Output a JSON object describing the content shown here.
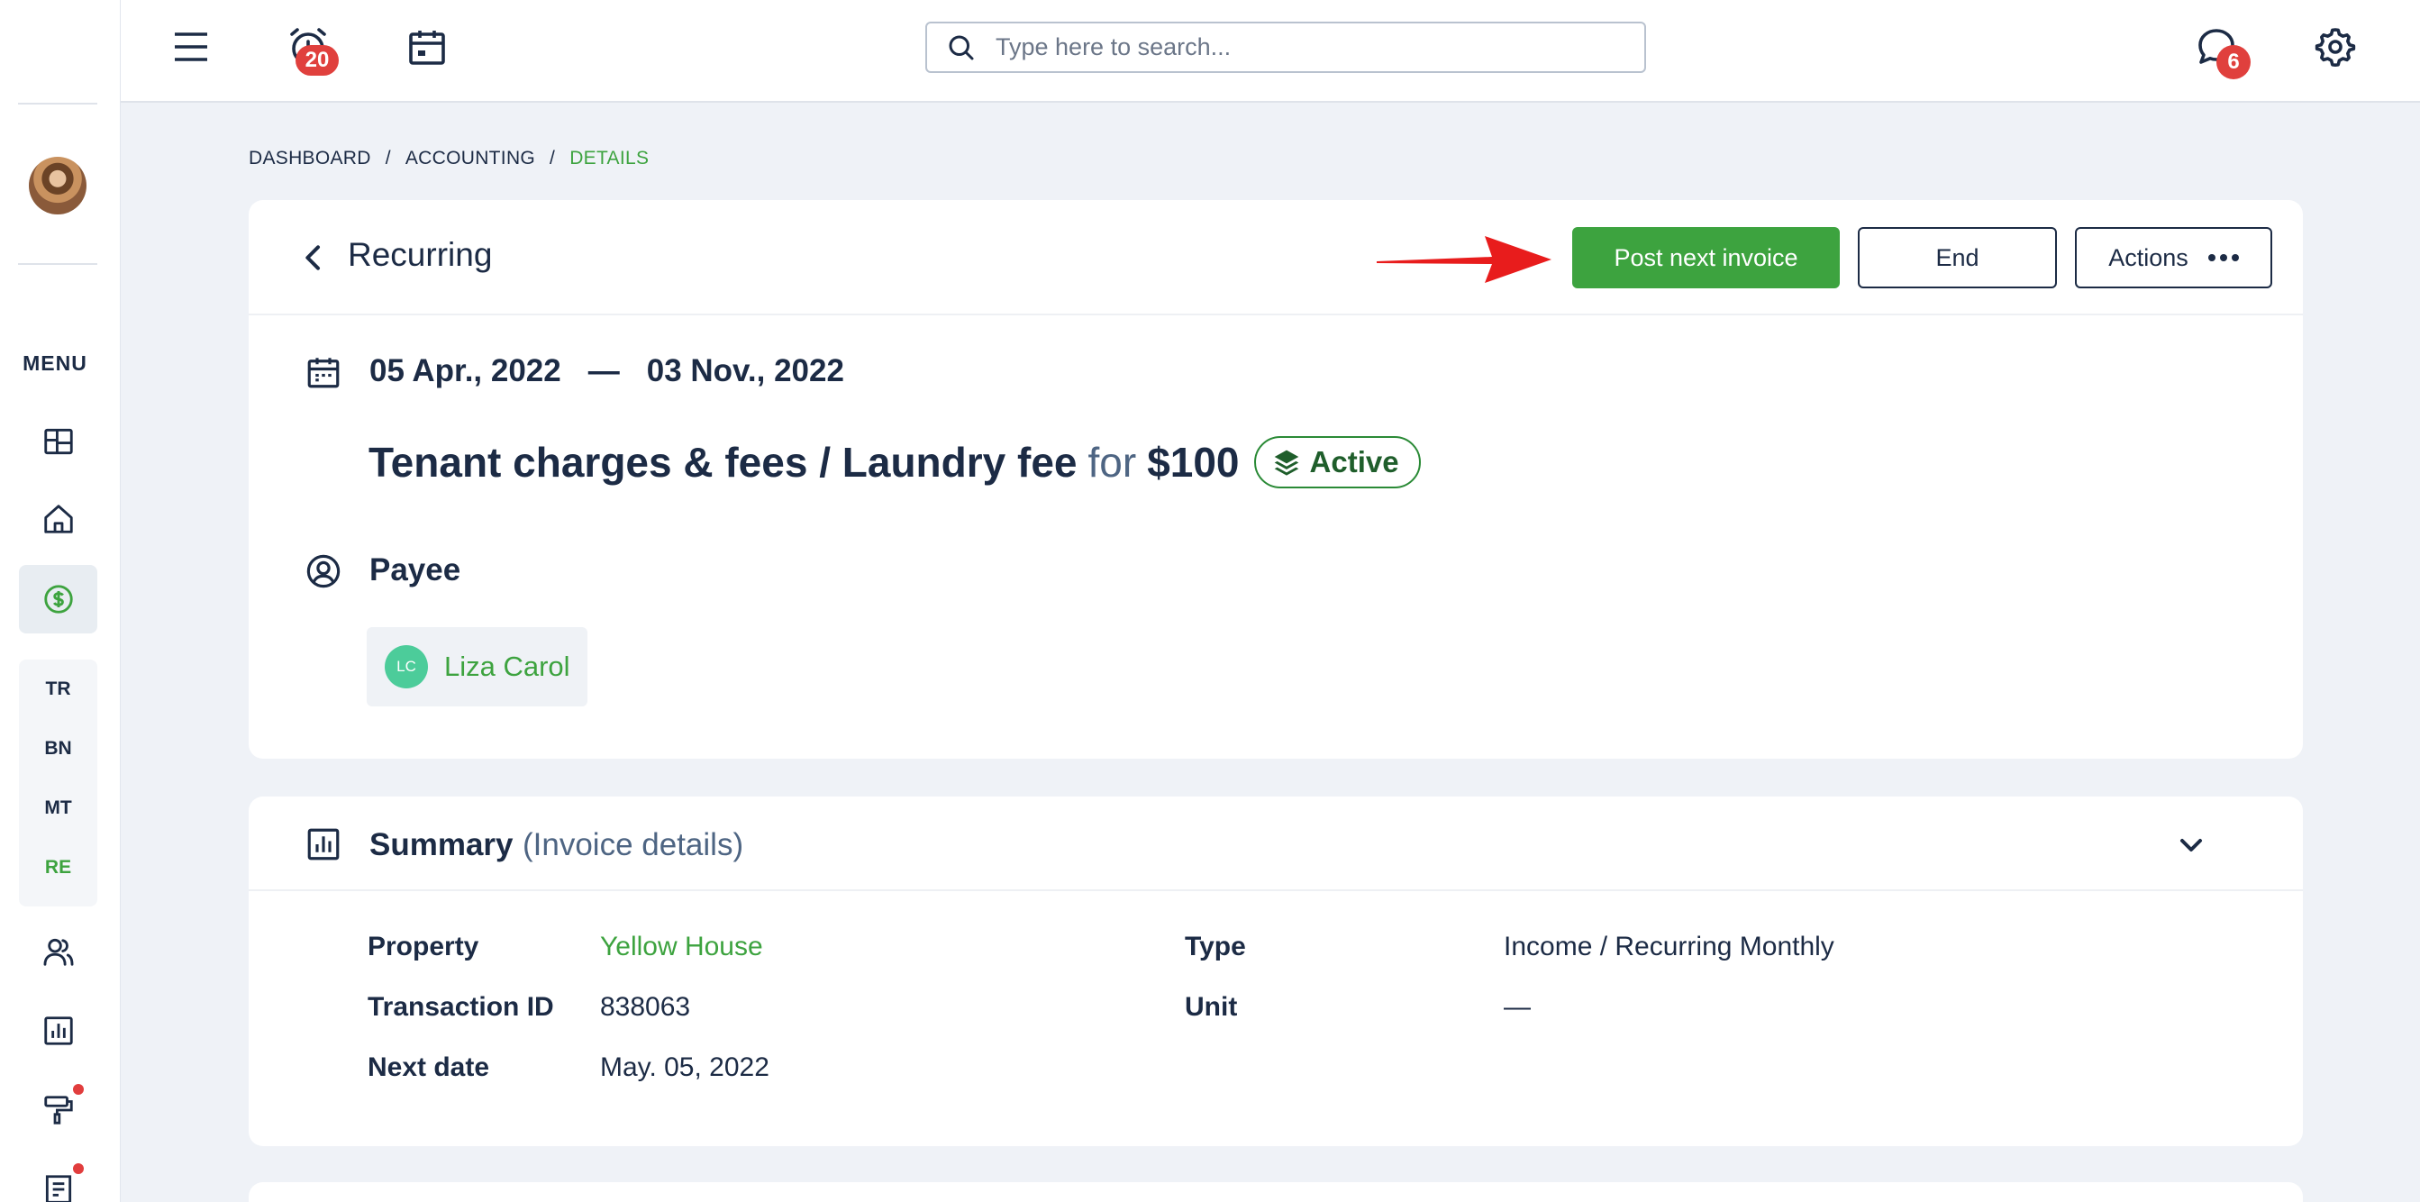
{
  "sidebar": {
    "menu_label": "MENU",
    "sub_items": [
      "TR",
      "BN",
      "MT",
      "RE"
    ],
    "active_sub": "RE"
  },
  "topbar": {
    "alarm_badge": "20",
    "chat_badge": "6",
    "search_placeholder": "Type here to search..."
  },
  "breadcrumb": {
    "items": [
      "DASHBOARD",
      "ACCOUNTING",
      "DETAILS"
    ],
    "separator": "/"
  },
  "detail": {
    "title": "Recurring",
    "post_button": "Post next invoice",
    "end_button": "End",
    "actions_button": "Actions",
    "date_start": "05 Apr., 2022",
    "date_sep": "—",
    "date_end": "03 Nov., 2022",
    "charge_name": "Tenant charges & fees / Laundry fee",
    "charge_for": "for",
    "amount": "$100",
    "status": "Active",
    "payee_label": "Payee",
    "payee_initials": "LC",
    "payee_name": "Liza Carol"
  },
  "summary": {
    "title": "Summary",
    "subtitle": "(Invoice details)",
    "fields": {
      "property_label": "Property",
      "property_value": "Yellow House",
      "transaction_label": "Transaction ID",
      "transaction_value": "838063",
      "next_date_label": "Next date",
      "next_date_value": "May. 05, 2022",
      "type_label": "Type",
      "type_value": "Income / Recurring Monthly",
      "unit_label": "Unit",
      "unit_value": "—"
    }
  },
  "colors": {
    "accent_green": "#3da33f",
    "navy": "#1c2b45",
    "badge_red": "#e0403d",
    "arrow_red": "#e81c1c"
  }
}
